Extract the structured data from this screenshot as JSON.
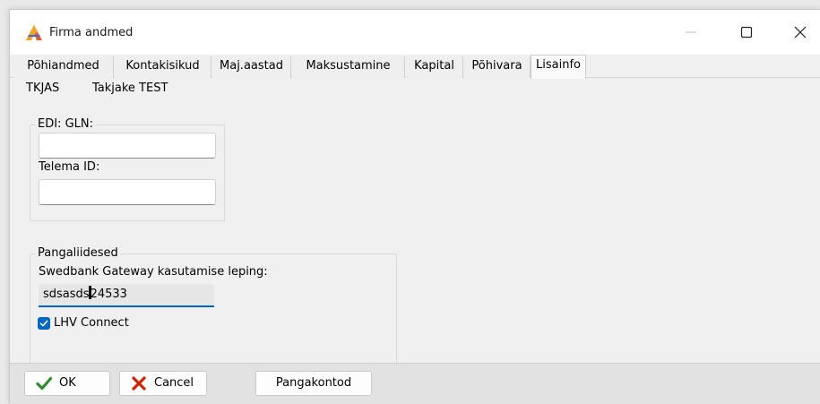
{
  "window": {
    "title": "Firma andmed",
    "icon": "app-logo-icon",
    "controls": [
      "minimize-icon",
      "maximize-icon",
      "close-icon"
    ]
  },
  "tabs": [
    {
      "label": "Põhiandmed",
      "active": false
    },
    {
      "label": "Kontakisikud",
      "active": false
    },
    {
      "label": "Maj.aastad",
      "active": false
    },
    {
      "label": "Maksustamine",
      "active": false
    },
    {
      "label": "Kapital",
      "active": false
    },
    {
      "label": "Põhivara",
      "active": false
    },
    {
      "label": "Lisainfo",
      "active": true
    }
  ],
  "company": {
    "code": "TKJAS",
    "name": "Takjake TEST"
  },
  "edi_group": {
    "legend": "EDI: GLN:",
    "gln_value": "",
    "telema_label": "Telema ID:",
    "telema_value": ""
  },
  "bank_group": {
    "legend": "Pangaliidesed",
    "swedbank_label": "Swedbank Gateway kasutamise leping:",
    "swedbank_value_before_caret": "sdsasds",
    "swedbank_value_after_caret": "24533",
    "lhv_label": "LHV Connect",
    "lhv_checked": true
  },
  "buttons": {
    "ok": "OK",
    "cancel": "Cancel",
    "bank_accounts": "Pangakontod"
  },
  "colors": {
    "accent": "#0067c0",
    "ok_check": "#2e8b2e",
    "cancel_x": "#cc2200"
  }
}
